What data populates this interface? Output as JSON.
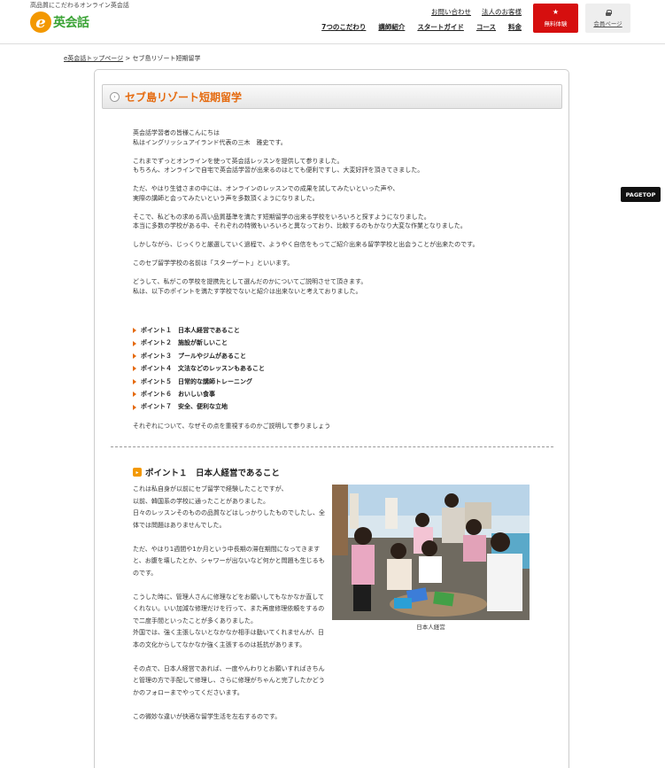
{
  "header": {
    "tagline": "高品質にこだわるオンライン英会話",
    "logo_letter": "e",
    "logo_text": "英会話",
    "top_links": [
      "お問い合わせ",
      "法人のお客様"
    ],
    "nav": [
      "7つのこだわり",
      "講師紹介",
      "スタートガイド",
      "コース",
      "料金"
    ],
    "trial_label": "無料体験",
    "member_label": "会員ページ"
  },
  "breadcrumb": {
    "home": "e英会話トップページ",
    "separator": " > ",
    "current": "セブ島リゾート短期留学"
  },
  "page": {
    "title": "セブ島リゾート短期留学",
    "intro": [
      "英会話学習者の皆様こんにちは\n私はイングリッシュアイランド代表の三木　雅史です。",
      "これまでずっとオンラインを使って英会話レッスンを提供して参りました。\nもちろん、オンラインで自宅で英会話学習が出来るのはとても便利ですし、大変好評を頂きてきました。",
      "ただ、やはり生徒さまの中には、オンラインのレッスンでの成果を試してみたいといった声や、\n実際の講師と会ってみたいという声を多数頂くようになりました。",
      "そこで、私どもの求める高い品質基準を満たす短期留学の出来る学校をいろいろと探すようになりました。\n本当に多数の学校がある中、それぞれの特徴もいろいろと異なっており、比較するのもかなり大変な作業となりました。",
      "しかしながら、じっくりと厳選していく過程で、ようやく自信をもってご紹介出来る留学学校と出会うことが出来たのです。",
      "このセブ留学学校の名前は「スターゲート」といいます。",
      "どうして、私がこの学校を提携先として選んだのかについてご説明させて頂きます。\n私は、以下のポイントを満たす学校でないと紹介は出来ないと考えておりました。"
    ],
    "points": [
      "ポイント１　日本人経営であること",
      "ポイント２　施設が新しいこと",
      "ポイント３　プールやジムがあること",
      "ポイント４　文法などのレッスンもあること",
      "ポイント５　日常的な講師トレーニング",
      "ポイント６　おいしい食事",
      "ポイント７　安全、便利な立地"
    ],
    "closing": "それぞれについて、なぜその点を重視するのかご説明して参りましょう"
  },
  "section1": {
    "title": "ポイント１　日本人経営であること",
    "paragraphs": [
      "これは私自身が以前にセブ留学で経験したことですが、\n以前、韓国系の学校に通ったことがありました。\n日々のレッスンそのものの品質などはしっかりしたものでしたし、全体では問題はありませんでした。",
      "ただ、やはり1週間や1か月という中長期の滞在期間になってきますと、お腹を壊したとか、シャワーが出ないなど何かと問題も生じるものです。",
      "こうした時に、管理人さんに修理などをお願いしてもなかなか直してくれない。いい加減な修理だけを行って、また再度修理依頼をするので二度手間といったことが多くありました。\n外国では、強く主張しないとなかなか相手は動いてくれませんが、日本の文化からしてなかなか強く主張するのは抵抗があります。",
      "その点で、日本人経営であれば、一度やんわりとお願いすればきちんと管理の方で手配して修理し、さらに修理がちゃんと完了したかどうかのフォローまでやってくださいます。",
      "この微妙な違いが快適な留学生活を左右するのです。"
    ],
    "photo_caption": "日本人経営"
  },
  "pagetop_label": "PAGETOP",
  "colors": {
    "accent": "#e56a0e",
    "trial": "#d60f0f",
    "logo_green": "#3aa335",
    "logo_orange": "#f39800"
  }
}
